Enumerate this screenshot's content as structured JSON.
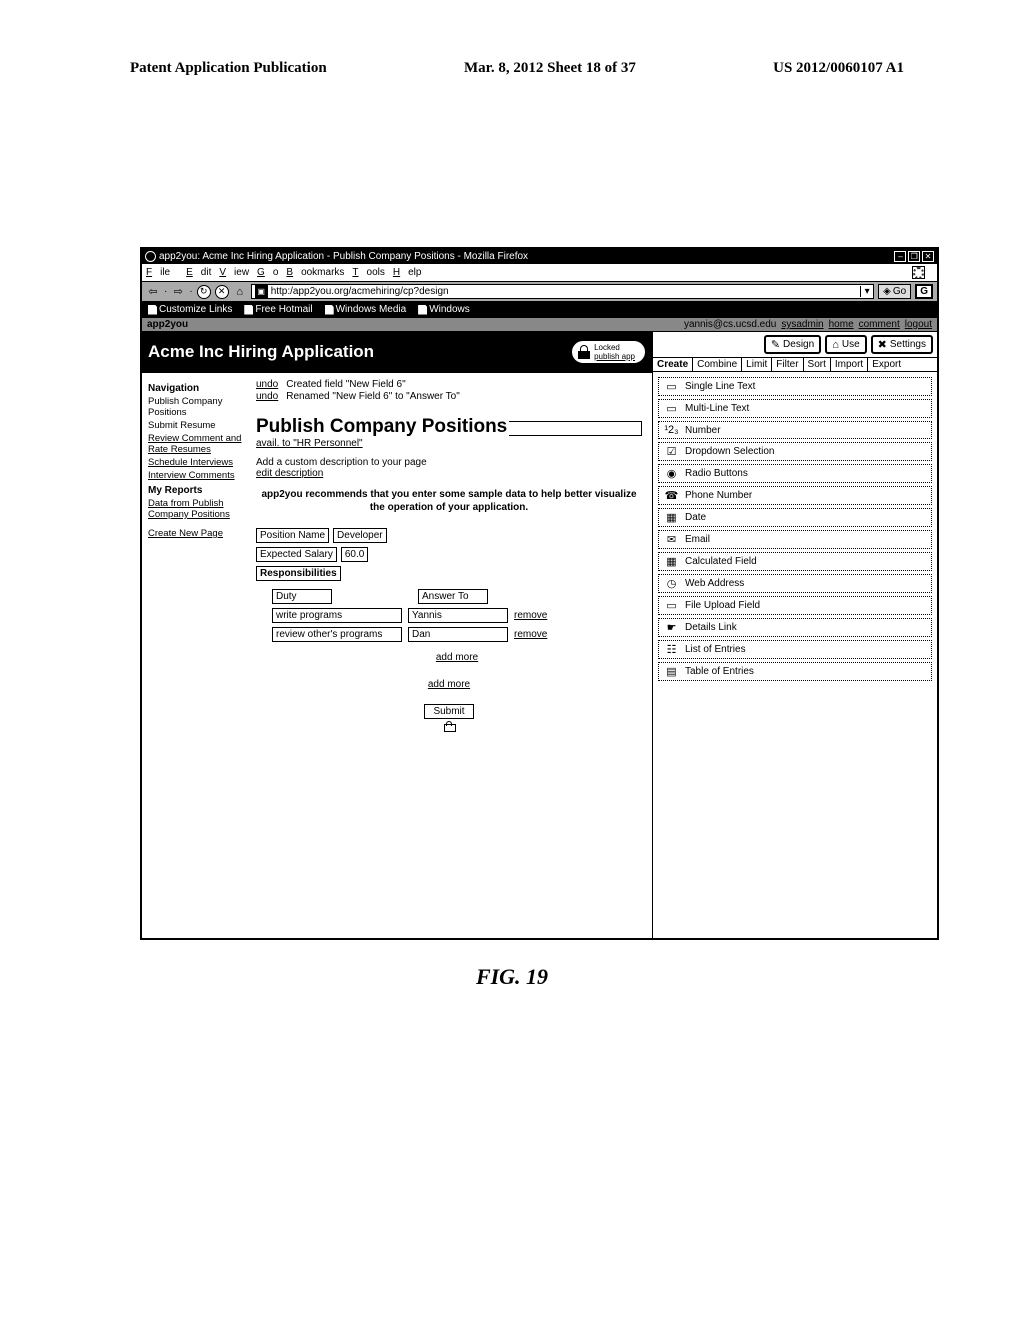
{
  "patent": {
    "left": "Patent Application Publication",
    "mid": "Mar. 8, 2012  Sheet 18 of 37",
    "right": "US 2012/0060107 A1"
  },
  "figure_caption": "FIG. 19",
  "title": "app2you: Acme Inc Hiring Application - Publish Company Positions - Mozilla Firefox",
  "menu": {
    "file": "File",
    "edit": "Edit",
    "view": "View",
    "go": "Go",
    "bookmarks": "Bookmarks",
    "tools": "Tools",
    "help": "Help"
  },
  "url": "http:/app2you.org/acmehiring/cp?design",
  "go": "Go",
  "g": "G",
  "bookmarkbar": {
    "a": "Customize Links",
    "b": "Free Hotmail",
    "c": "Windows Media",
    "d": "Windows"
  },
  "appbar": {
    "brand": "app2you",
    "user": "yannis@cs.ucsd.edu",
    "links": [
      "sysadmin",
      "home",
      "comment",
      "logout"
    ]
  },
  "app_title": "Acme Inc Hiring Application",
  "lock": {
    "top": "Locked",
    "bottom": "publish app"
  },
  "nav": {
    "h1": "Navigation",
    "items": [
      "Publish Company Positions",
      "Submit Resume",
      "Review Comment and Rate Resumes",
      "Schedule Interviews",
      "Interview Comments"
    ],
    "h2": "My Reports",
    "rep": "Data from Publish Company Positions",
    "create": "Create New Page"
  },
  "undo": {
    "label": "undo",
    "r1": "Created field \"New Field 6\"",
    "r2": "Renamed \"New Field 6\" to \"Answer To\""
  },
  "page_heading": "Publish Company Positions",
  "avail": "avail. to \"HR Personnel\"",
  "desc1": "Add a custom description to your page",
  "desc2": "edit description",
  "reco": "app2you recommends that you enter some sample data to help better visualize the operation of your application.",
  "form": {
    "posLabel": "Position Name",
    "posVal": "Developer",
    "salLabel": "Expected Salary",
    "salVal": "60.0",
    "respLabel": "Responsibilities",
    "colA": "Duty",
    "colB": "Answer To",
    "r1a": "write programs",
    "r1b": "Yannis",
    "r2a": "review other's programs",
    "r2b": "Dan",
    "remove": "remove",
    "addmore": "add more",
    "submit": "Submit"
  },
  "modes": {
    "design": "Design",
    "use": "Use",
    "settings": "Settings"
  },
  "tabs": [
    "Create",
    "Combine",
    "Limit",
    "Filter",
    "Sort",
    "Import",
    "Export"
  ],
  "fields": [
    {
      "icon": "▭",
      "label": "Single Line Text"
    },
    {
      "icon": "▭",
      "label": "Multi-Line Text"
    },
    {
      "icon": "¹2₃",
      "label": "Number"
    },
    {
      "icon": "☑",
      "label": "Dropdown Selection"
    },
    {
      "icon": "◉",
      "label": "Radio Buttons"
    },
    {
      "icon": "☎",
      "label": "Phone Number"
    },
    {
      "icon": "▦",
      "label": "Date"
    },
    {
      "icon": "✉",
      "label": "Email"
    },
    {
      "icon": "▦",
      "label": "Calculated Field"
    },
    {
      "icon": "◷",
      "label": "Web Address"
    },
    {
      "icon": "▭",
      "label": "File Upload Field"
    },
    {
      "icon": "☛",
      "label": "Details Link"
    },
    {
      "icon": "☷",
      "label": "List of Entries"
    },
    {
      "icon": "▤",
      "label": "Table of Entries"
    }
  ]
}
